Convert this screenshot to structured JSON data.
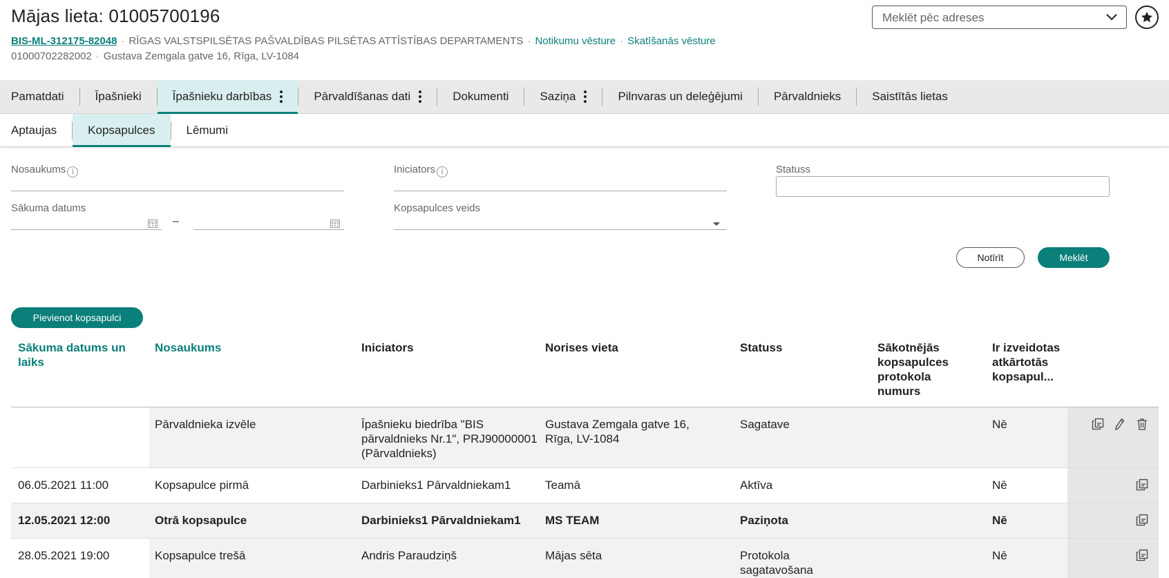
{
  "header": {
    "title": "Mājas lieta: 01005700196",
    "case_id": "BIS-ML-312175-82048",
    "department": "RĪGAS VALSTSPILSĒTAS PAŠVALDĪBAS PILSĒTAS ATTĪSTĪBAS DEPARTAMENTS",
    "event_history": "Notikumu vēsture",
    "view_history": "Skatīšanās vēsture",
    "cadastre_no": "01000702282002",
    "address": "Gustava Zemgala gatve 16, Rīga, LV-1084",
    "address_search_placeholder": "Meklēt pēc adreses"
  },
  "main_tabs": [
    {
      "label": "Pamatdati"
    },
    {
      "label": "Īpašnieki"
    },
    {
      "label": "Īpašnieku darbības",
      "active": true,
      "menu": true
    },
    {
      "label": "Pārvaldīšanas dati",
      "menu": true
    },
    {
      "label": "Dokumenti"
    },
    {
      "label": "Saziņa",
      "menu": true
    },
    {
      "label": "Pilnvaras un deleģējumi"
    },
    {
      "label": "Pārvaldnieks"
    },
    {
      "label": "Saistītās lietas"
    }
  ],
  "sub_tabs": [
    {
      "label": "Aptaujas"
    },
    {
      "label": "Kopsapulces",
      "active": true
    },
    {
      "label": "Lēmumi"
    }
  ],
  "filters": {
    "name_label": "Nosaukums",
    "initiator_label": "Iniciators",
    "status_label": "Statuss",
    "start_date_label": "Sākuma datums",
    "date_separator": "–",
    "meeting_type_label": "Kopsapulces veids",
    "clear_button": "Notīrīt",
    "search_button": "Meklēt",
    "info_glyph": "i"
  },
  "add_button": "Pievienot kopsapulci",
  "table": {
    "headers": {
      "start": "Sākuma datums un laiks",
      "name": "Nosaukums",
      "initiator": "Iniciators",
      "venue": "Norises vieta",
      "status": "Statuss",
      "protocol": "Sākotnējās kopsapulces protokola numurs",
      "repeat": "Ir izveidotas atkārtotās kopsapul..."
    },
    "rows": [
      {
        "start": "",
        "name": "Pārvaldnieka izvēle",
        "initiator": "Īpašnieku biedrība \"BIS pārvaldnieks Nr.1\", PRJ90000001 (Pārvaldnieks)",
        "venue": "Gustava Zemgala gatve 16, Rīga, LV-1084",
        "status": "Sagatave",
        "protocol": "",
        "repeat": "Nē",
        "actions": [
          "copy-icon",
          "edit-icon",
          "delete-icon"
        ]
      },
      {
        "start": "06.05.2021 11:00",
        "name": "Kopsapulce pirmā",
        "initiator": "Darbinieks1 Pārvaldniekam1",
        "venue": "Teamā",
        "status": "Aktīva",
        "protocol": "",
        "repeat": "Nē",
        "actions": [
          "copy-icon"
        ]
      },
      {
        "start": "12.05.2021 12:00",
        "name": "Otrā kopsapulce",
        "initiator": "Darbinieks1 Pārvaldniekam1",
        "venue": "MS TEAM",
        "status": "Paziņota",
        "protocol": "",
        "repeat": "Nē",
        "bold": true,
        "actions": [
          "copy-icon"
        ]
      },
      {
        "start": "28.05.2021 19:00",
        "name": "Kopsapulce trešā",
        "initiator": "Andris Paraudziņš",
        "venue": "Mājas sēta",
        "status": "Protokola sagatavošana",
        "protocol": "",
        "repeat": "Nē",
        "actions": [
          "copy-icon"
        ]
      }
    ]
  },
  "colors": {
    "accent": "#0b7f7a",
    "tab_active_bg": "#d9efef",
    "tab_bar_bg": "#e9e9e9"
  }
}
